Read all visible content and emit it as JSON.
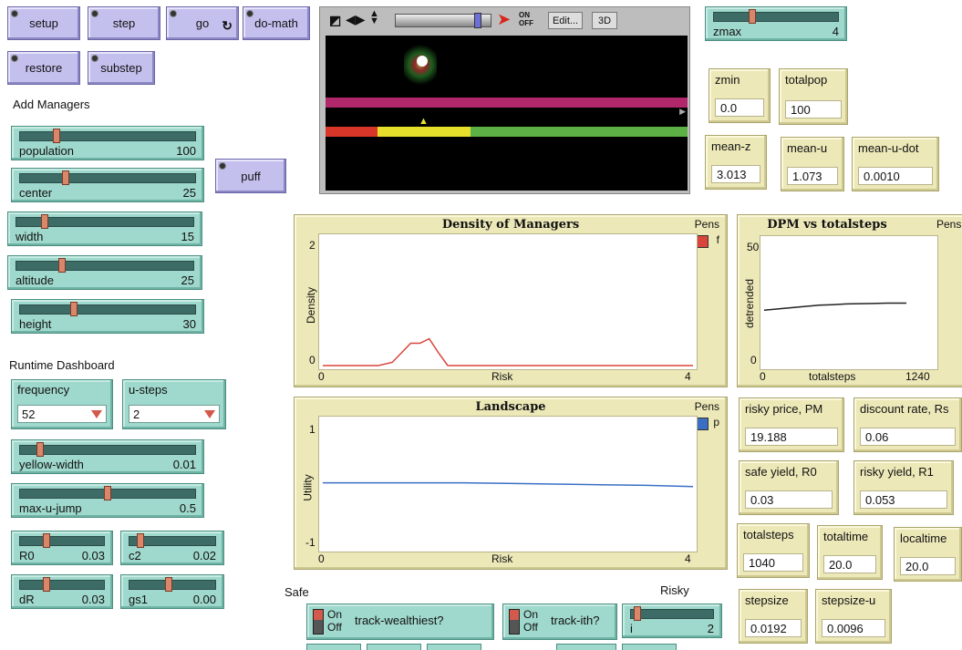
{
  "buttons": {
    "setup": "setup",
    "step": "step",
    "go": "go",
    "do_math": "do-math",
    "restore": "restore",
    "substep": "substep",
    "puff": "puff"
  },
  "labels": {
    "add_managers": "Add Managers",
    "runtime_dashboard": "Runtime Dashboard",
    "safe": "Safe",
    "risky": "Risky"
  },
  "sliders": {
    "population": {
      "label": "population",
      "value": "100",
      "level": 0.2
    },
    "center": {
      "label": "center",
      "value": "25",
      "level": 0.25
    },
    "width": {
      "label": "width",
      "value": "15",
      "level": 0.15
    },
    "altitude": {
      "label": "altitude",
      "value": "25",
      "level": 0.25
    },
    "height": {
      "label": "height",
      "value": "30",
      "level": 0.3
    },
    "yellow_width": {
      "label": "yellow-width",
      "value": "0.01",
      "level": 0.1
    },
    "max_u_jump": {
      "label": "max-u-jump",
      "value": "0.5",
      "level": 0.5
    },
    "R0": {
      "label": "R0",
      "value": "0.03",
      "level": 0.3
    },
    "c2": {
      "label": "c2",
      "value": "0.02",
      "level": 0.1
    },
    "dR": {
      "label": "dR",
      "value": "0.03",
      "level": 0.3
    },
    "gs1": {
      "label": "gs1",
      "value": "0.00",
      "level": 0.45
    },
    "zmax": {
      "label": "zmax",
      "value": "4",
      "level": 0.3
    },
    "i": {
      "label": "i",
      "value": "2",
      "level": 0.05
    }
  },
  "choosers": {
    "frequency": {
      "label": "frequency",
      "value": "52"
    },
    "u_steps": {
      "label": "u-steps",
      "value": "2"
    }
  },
  "monitors": {
    "zmin": {
      "label": "zmin",
      "value": "0.0"
    },
    "totalpop": {
      "label": "totalpop",
      "value": "100"
    },
    "mean_z": {
      "label": "mean-z",
      "value": "3.013"
    },
    "mean_u": {
      "label": "mean-u",
      "value": "1.073"
    },
    "mean_u_dot": {
      "label": "mean-u-dot",
      "value": "0.0010"
    },
    "risky_price": {
      "label": "risky price, PM",
      "value": "19.188"
    },
    "discount_rate": {
      "label": "discount rate, Rs",
      "value": "0.06"
    },
    "safe_yield": {
      "label": "safe yield, R0",
      "value": "0.03"
    },
    "risky_yield": {
      "label": "risky yield, R1",
      "value": "0.053"
    },
    "totalsteps": {
      "label": "totalsteps",
      "value": "1040"
    },
    "totaltime": {
      "label": "totaltime",
      "value": "20.0"
    },
    "localtime": {
      "label": "localtime",
      "value": "20.0"
    },
    "stepsize": {
      "label": "stepsize",
      "value": "0.0192"
    },
    "stepsize_u": {
      "label": "stepsize-u",
      "value": "0.0096"
    }
  },
  "switches": {
    "track_wealthiest": {
      "on": "On",
      "off": "Off",
      "label": "track-wealthiest?"
    },
    "track_ith": {
      "on": "On",
      "off": "Off",
      "label": "track-ith?"
    }
  },
  "view_toolbar": {
    "edit_label": "Edit...",
    "three_d_label": "3D",
    "on_label": "ON",
    "off_label": "OFF",
    "speed_level": 0.9
  },
  "chart_data": [
    {
      "type": "line",
      "title": "Density of Managers",
      "xlabel": "Risk",
      "ylabel": "Density",
      "xlim": [
        0,
        4
      ],
      "ylim": [
        0,
        2
      ],
      "x_tick_labels": [
        "0",
        "4"
      ],
      "y_tick_labels": [
        "0",
        "2"
      ],
      "legend_title": "Pens",
      "series": [
        {
          "name": "f",
          "color": "#d9453c",
          "x": [
            0,
            0.6,
            0.75,
            0.85,
            0.95,
            1.05,
            1.15,
            1.25,
            1.35,
            1.45,
            4
          ],
          "y": [
            0,
            0,
            0.05,
            0.2,
            0.35,
            0.35,
            0.42,
            0.2,
            0.0,
            0,
            0
          ]
        }
      ]
    },
    {
      "type": "line",
      "title": "DPM vs totalsteps",
      "xlabel": "totalsteps",
      "ylabel": "detrended",
      "xlim": [
        0,
        1240
      ],
      "ylim": [
        0,
        50
      ],
      "x_tick_labels": [
        "0",
        "1240"
      ],
      "y_tick_labels": [
        "0",
        "50"
      ],
      "legend_title": "Pens",
      "series": [
        {
          "color": "#222222",
          "x": [
            0,
            100,
            200,
            300,
            400,
            500,
            600,
            700,
            800,
            900,
            1000,
            1040
          ],
          "y": [
            22,
            22.5,
            23,
            23.5,
            24,
            24.2,
            24.5,
            24.6,
            24.7,
            24.8,
            24.8,
            24.8
          ]
        }
      ]
    },
    {
      "type": "line",
      "title": "Landscape",
      "xlabel": "Risk",
      "ylabel": "Utility",
      "xlim": [
        0,
        4
      ],
      "ylim": [
        -1,
        1
      ],
      "x_tick_labels": [
        "0",
        "4"
      ],
      "y_tick_labels": [
        "-1",
        "1"
      ],
      "legend_title": "Pens",
      "series": [
        {
          "name": "p",
          "color": "#3a6fc4",
          "x": [
            0,
            0.5,
            1,
            1.5,
            2,
            2.5,
            3,
            3.5,
            4
          ],
          "y": [
            0.02,
            0.02,
            0.02,
            0.02,
            0.01,
            0.0,
            -0.01,
            -0.02,
            -0.04
          ]
        }
      ]
    }
  ]
}
